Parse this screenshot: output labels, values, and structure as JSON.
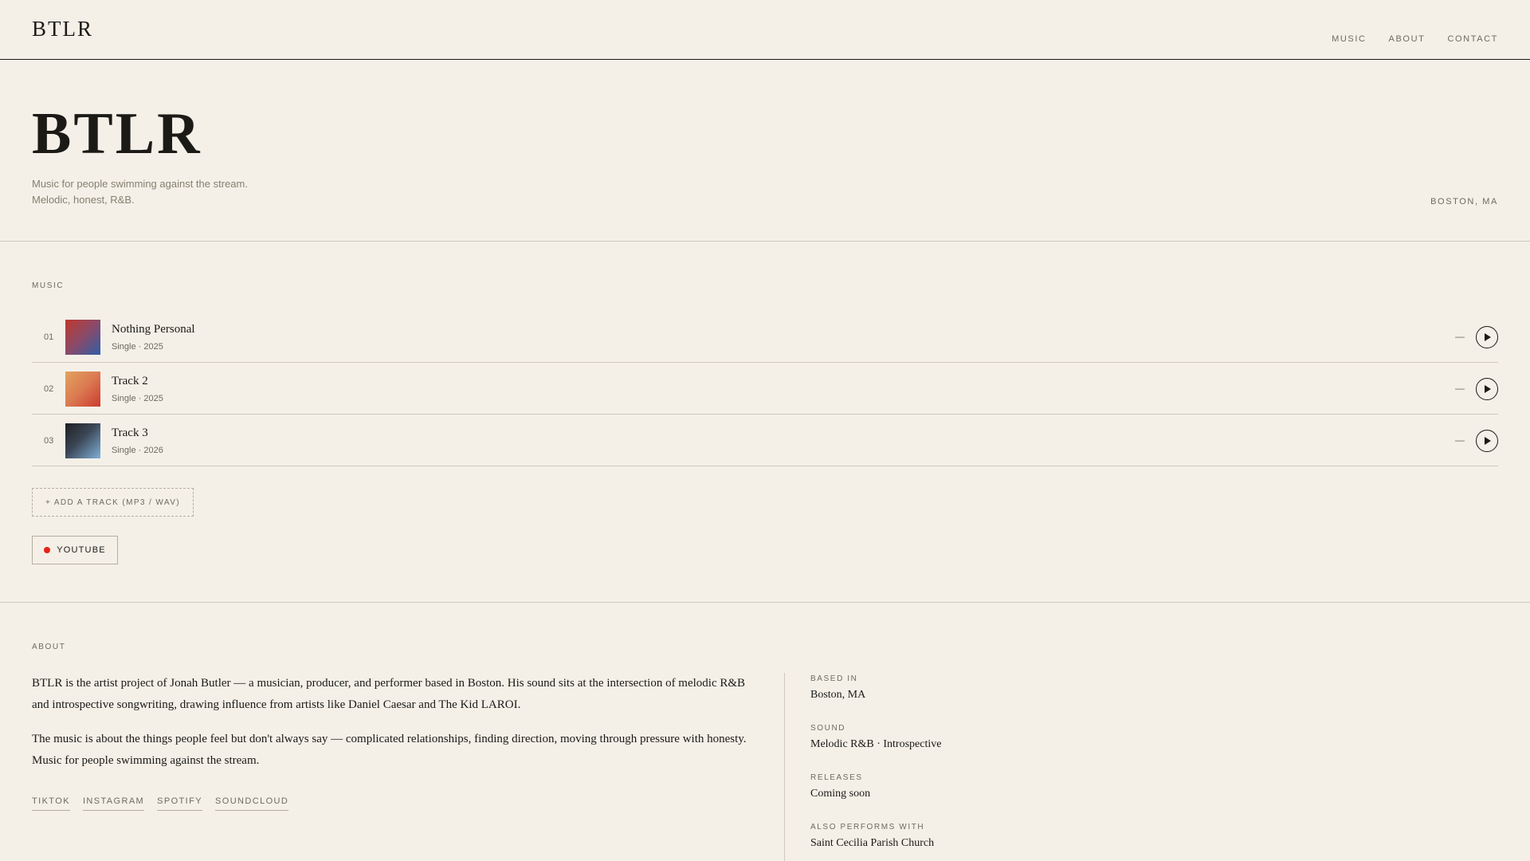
{
  "header": {
    "logo": "BTLR",
    "nav": [
      "MUSIC",
      "ABOUT",
      "CONTACT"
    ]
  },
  "hero": {
    "title": "BTLR",
    "subtitle_line1": "Music for people swimming against the stream.",
    "subtitle_line2": "Melodic, honest, R&B.",
    "location": "BOSTON, MA"
  },
  "music": {
    "label": "MUSIC",
    "tracks": [
      {
        "num": "01",
        "title": "Nothing Personal",
        "meta": "Single · 2025",
        "duration": "—"
      },
      {
        "num": "02",
        "title": "Track 2",
        "meta": "Single · 2025",
        "duration": "—"
      },
      {
        "num": "03",
        "title": "Track 3",
        "meta": "Single · 2026",
        "duration": "—"
      }
    ],
    "add_track_label": "+ ADD A TRACK (MP3 / WAV)",
    "youtube_label": "YOUTUBE",
    "colors": {
      "youtube_dot": "#e62117"
    }
  },
  "about": {
    "label": "ABOUT",
    "paragraphs": [
      "BTLR is the artist project of Jonah Butler — a musician, producer, and performer based in Boston. His sound sits at the intersection of melodic R&B and introspective songwriting, drawing influence from artists like Daniel Caesar and The Kid LAROI.",
      "The music is about the things people feel but don't always say — complicated relationships, finding direction, moving through pressure with honesty. Music for people swimming against the stream."
    ],
    "socials": [
      "TIKTOK",
      "INSTAGRAM",
      "SPOTIFY",
      "SOUNDCLOUD"
    ],
    "facts": [
      {
        "label": "BASED IN",
        "value": "Boston, MA"
      },
      {
        "label": "SOUND",
        "value": "Melodic R&B · Introspective"
      },
      {
        "label": "RELEASES",
        "value": "Coming soon"
      },
      {
        "label": "ALSO PERFORMS WITH",
        "value": "Saint Cecilia Parish Church"
      }
    ]
  }
}
